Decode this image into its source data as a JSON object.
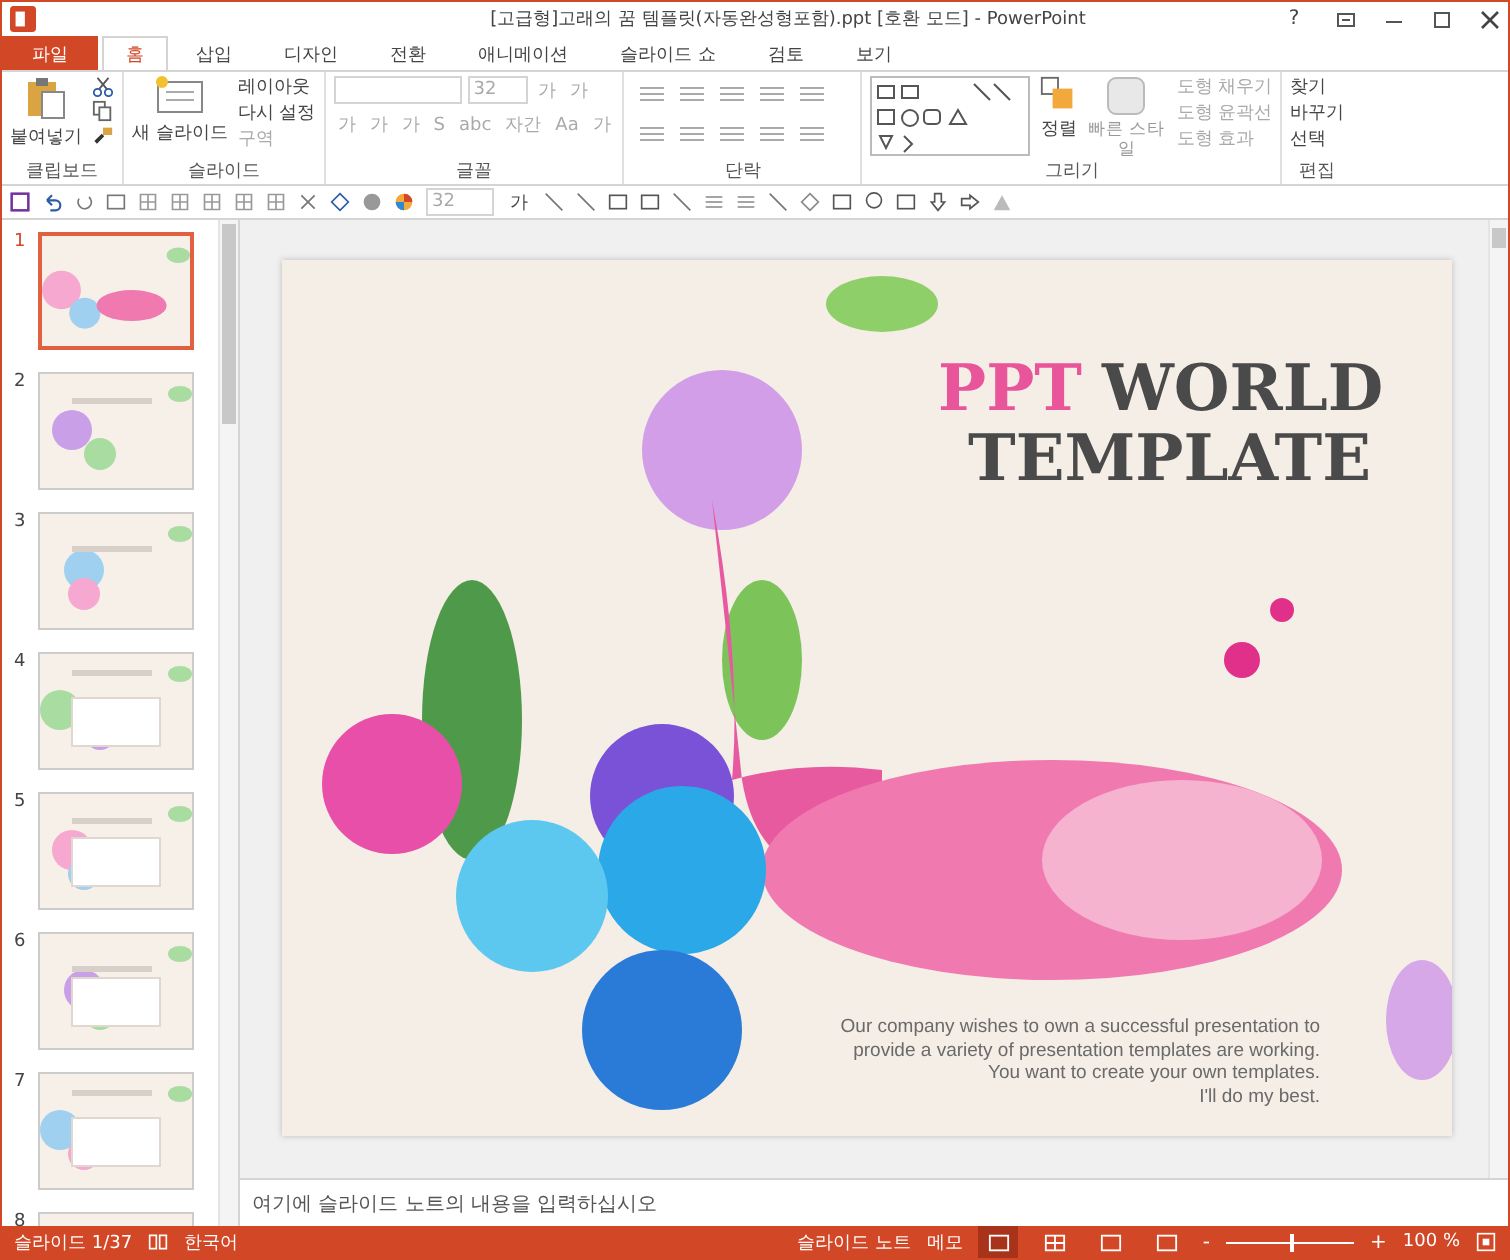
{
  "window": {
    "title": "[고급형]고래의 꿈 템플릿(자동완성형포함).ppt [호환 모드] - PowerPoint",
    "help": "?"
  },
  "tabs": [
    {
      "label": "파일",
      "kind": "file",
      "selected": false
    },
    {
      "label": "홈",
      "kind": "tab",
      "selected": true
    },
    {
      "label": "삽입",
      "kind": "tab",
      "selected": false
    },
    {
      "label": "디자인",
      "kind": "tab",
      "selected": false
    },
    {
      "label": "전환",
      "kind": "tab",
      "selected": false
    },
    {
      "label": "애니메이션",
      "kind": "tab",
      "selected": false
    },
    {
      "label": "슬라이드 쇼",
      "kind": "tab",
      "selected": false
    },
    {
      "label": "검토",
      "kind": "tab",
      "selected": false
    },
    {
      "label": "보기",
      "kind": "tab",
      "selected": false
    }
  ],
  "ribbon": {
    "clipboard": {
      "label": "클립보드",
      "paste": "붙여넣기"
    },
    "slides": {
      "label": "슬라이드",
      "new_slide": "새 슬라이드",
      "items": [
        {
          "label": "레이아웃",
          "disabled": false
        },
        {
          "label": "다시 설정",
          "disabled": false
        },
        {
          "label": "구역",
          "disabled": true
        }
      ]
    },
    "font": {
      "label": "글꼴",
      "size": "32",
      "grow": "가",
      "shrink": "가",
      "styles": [
        "가",
        "가",
        "가",
        "S",
        "abc",
        "자간",
        "Aa",
        "가"
      ]
    },
    "paragraph": {
      "label": "단락"
    },
    "drawing": {
      "label": "그리기",
      "arrange": "정렬",
      "quick_styles": "빠른 스타일",
      "items": [
        {
          "label": "도형 채우기",
          "disabled": true
        },
        {
          "label": "도형 윤곽선",
          "disabled": true
        },
        {
          "label": "도형 효과",
          "disabled": true
        }
      ]
    },
    "editing": {
      "label": "편집",
      "items": [
        "찾기",
        "바꾸기",
        "선택"
      ]
    }
  },
  "quick_toolbar": {
    "size": "32",
    "font_color": "가"
  },
  "thumbnails": [
    {
      "number": "1",
      "selected": true
    },
    {
      "number": "2",
      "selected": false
    },
    {
      "number": "3",
      "selected": false
    },
    {
      "number": "4",
      "selected": false
    },
    {
      "number": "5",
      "selected": false
    },
    {
      "number": "6",
      "selected": false
    },
    {
      "number": "7",
      "selected": false
    },
    {
      "number": "8",
      "selected": false
    }
  ],
  "slide": {
    "title_accent": "PPT",
    "title_rest": "WORLD",
    "title_line2": "TEMPLATE",
    "body": [
      "Our company wishes to own a successful presentation to",
      "provide a variety of presentation templates are working.",
      "You want to create your own templates.",
      "I'll do my best."
    ]
  },
  "notes": {
    "placeholder": "여기에 슬라이드 노트의 내용을 입력하십시오"
  },
  "status_bar": {
    "slide": "슬라이드 1/37",
    "language": "한국어",
    "notes": "슬라이드 노트",
    "comments": "메모",
    "views": [
      {
        "selected": true
      },
      {
        "selected": false
      },
      {
        "selected": false
      },
      {
        "selected": false
      }
    ],
    "zoom_minus": "-",
    "zoom_plus": "+",
    "zoom": {
      "level": 0.5
    },
    "zoom_text": "100 %"
  }
}
